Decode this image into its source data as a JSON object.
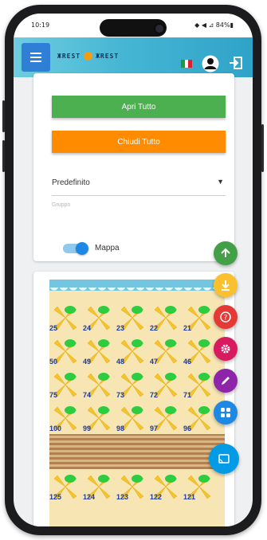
{
  "status": {
    "time": "10:19",
    "icons_text": "◆ ◀ ⊿ 84%▮"
  },
  "app": {
    "logo_left": "ЖREST",
    "logo_right": "ЖREST"
  },
  "card1": {
    "open_all_label": "Apri Tutto",
    "close_all_label": "Chiudi Tutto",
    "select_value": "Predefinito",
    "group_label": "Gruppo",
    "toggle_label": "Mappa"
  },
  "map": {
    "rows": [
      [
        "25",
        "24",
        "23",
        "22",
        "21"
      ],
      [
        "50",
        "49",
        "48",
        "47",
        "46"
      ],
      [
        "75",
        "74",
        "73",
        "72",
        "71"
      ],
      [
        "100",
        "99",
        "98",
        "97",
        "96"
      ],
      [
        "125",
        "124",
        "123",
        "122",
        "121"
      ]
    ]
  },
  "fabs": [
    {
      "name": "scroll-up",
      "icon": "arrow-up-icon",
      "color": "#43a047"
    },
    {
      "name": "download",
      "icon": "download-icon",
      "color": "#fbc02d"
    },
    {
      "name": "help",
      "icon": "help-icon",
      "color": "#e53935"
    },
    {
      "name": "settings",
      "icon": "gear-icon",
      "color": "#d81b60"
    },
    {
      "name": "edit",
      "icon": "pencil-icon",
      "color": "#8e24aa"
    },
    {
      "name": "grid",
      "icon": "grid-icon",
      "color": "#1e88e5"
    },
    {
      "name": "cast",
      "icon": "cast-icon",
      "color": "#039be5"
    }
  ]
}
